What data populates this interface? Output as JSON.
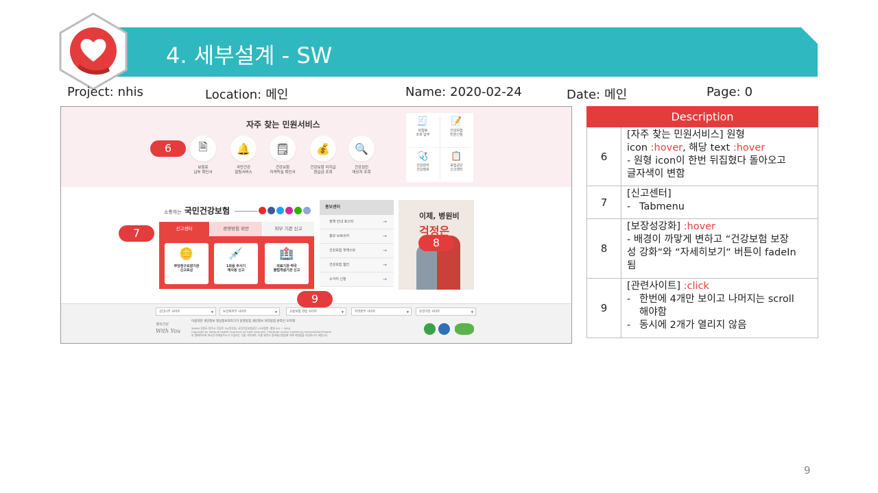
{
  "header": {
    "title": "4.  세부설계 - SW",
    "banner_color": "#2fb8bf"
  },
  "meta": {
    "project_label": "Project:",
    "project_value": "nhis",
    "location_label": "Location:",
    "location_value": "메인",
    "name_label": "Name:",
    "name_value": "2020-02-24",
    "date_label": "Date:",
    "date_value": "메인",
    "page_label": "Page:",
    "page_value": "0"
  },
  "screenshot": {
    "fav_title": "자주 찾는 민원서비스",
    "services": [
      {
        "icon": "document-icon",
        "glyph": "🗎",
        "label1": "보험료",
        "label2": "납부 확인서"
      },
      {
        "icon": "bell-icon",
        "glyph": "🔔",
        "label1": "국민건강",
        "label2": "알림서비스"
      },
      {
        "icon": "certificate-icon",
        "glyph": "🗒",
        "label1": "건강보험",
        "label2": "자격득실 확인서"
      },
      {
        "icon": "refund-icon",
        "glyph": "💰",
        "label1": "건강보험 미지급",
        "label2": "환급금 조회"
      },
      {
        "icon": "magnifier-icon",
        "glyph": "🔍",
        "label1": "건강검진",
        "label2": "대상자 조회"
      }
    ],
    "quick": [
      {
        "icon": "payment-icon",
        "glyph": "🧾",
        "label1": "보험료",
        "label2": "조회 납부"
      },
      {
        "icon": "petition-icon",
        "glyph": "📝",
        "label1": "건강보험",
        "label2": "민원신청"
      },
      {
        "icon": "health-icon",
        "glyph": "🩺",
        "label1": "건강관리",
        "label2": "건강정보"
      },
      {
        "icon": "report-icon",
        "glyph": "📋",
        "label1": "보험공단",
        "label2": "신고센터"
      }
    ],
    "comm_prefix": "소통하는",
    "comm_brand": "국민건강보험",
    "tabs": [
      "신고센터",
      "경영방침 위반",
      "외부 기관 신고"
    ],
    "cards": [
      {
        "icon": "coins-icon",
        "glyph": "🪙",
        "label1": "부당청구요양기관",
        "label2": "신고포상"
      },
      {
        "icon": "syringe-icon",
        "glyph": "💉",
        "label1": "1회용 주사기",
        "label2": "재사용 신고"
      },
      {
        "icon": "hospital-icon",
        "glyph": "🏥",
        "label1": "의료기관·약국",
        "label2": "불법개설기관 신고"
      }
    ],
    "notice_title": "홍보센터",
    "notice_items": [
      "정책 안내 포스터",
      "홍보 브로슈어",
      "건강보험 팟캐스트",
      "건강보험 웹진",
      "소식지 신청"
    ],
    "promo_line1": "이제, 병원비",
    "promo_line2": "걱정은",
    "footer_selects": [
      "공단나부 사이트",
      "보건복지부 사이트",
      "고용보험 관련 사이트",
      "지역본부 사이트",
      "유관기관 사이트"
    ],
    "footer_logo1": "행복건강",
    "footer_logo2": "With You",
    "footer_links": "이용약관   개인정보   영상정보처리기기 운영방침   개인정보 처리방침   온라인 오프제",
    "footer_copy1": "26464 강원도 원주시 건강로 32(반곡동) 국민건강보험공단 (사서함번: 평일 9시 ~ 18시)",
    "footer_copy2": "Copyright by national health insurance all right reserved. Character vector created by macrovector/Freepik",
    "footer_copy3": "본 홈페이지에 게시된 이메일주소가 수집되는 것을 거부하며, 이를 위반시 정보통신망법에 의해 처벌됨을 유념하시기 바랍니다."
  },
  "callouts": [
    "6",
    "7",
    "8",
    "9"
  ],
  "description": {
    "header": "Description",
    "rows": [
      {
        "num": "6",
        "l1": "[자주 찾는 민원서비스] 원형",
        "l2a": "icon ",
        "l2b": ":hover",
        "l2c": ", 해당 text ",
        "l2d": ":hover",
        "l3": "- 원형 icon이 한번 뒤집혔다 돌아오고",
        "l4": "글자색이 변함"
      },
      {
        "num": "7",
        "l1": "[신고센터]",
        "dash": "-",
        "l2": "Tabmenu"
      },
      {
        "num": "8",
        "l1a": "[보장성강화] ",
        "l1b": ":hover",
        "l2": "- 배경이 까맣게 변하고 “건강보험 보장",
        "l3": "성 강화“와 “자세히보기“ 버튼이 fadeIn",
        "l4": "됨"
      },
      {
        "num": "9",
        "l1a": "[관련사이트] ",
        "l1b": ":click",
        "dash": "-",
        "l2": "한번에 4개만 보이고 나머지는 scroll",
        "l3": "해야함",
        "l4": "동시에 2개가 열리지 않음"
      }
    ],
    "accent": "#e43c3c"
  },
  "page_number": "9"
}
